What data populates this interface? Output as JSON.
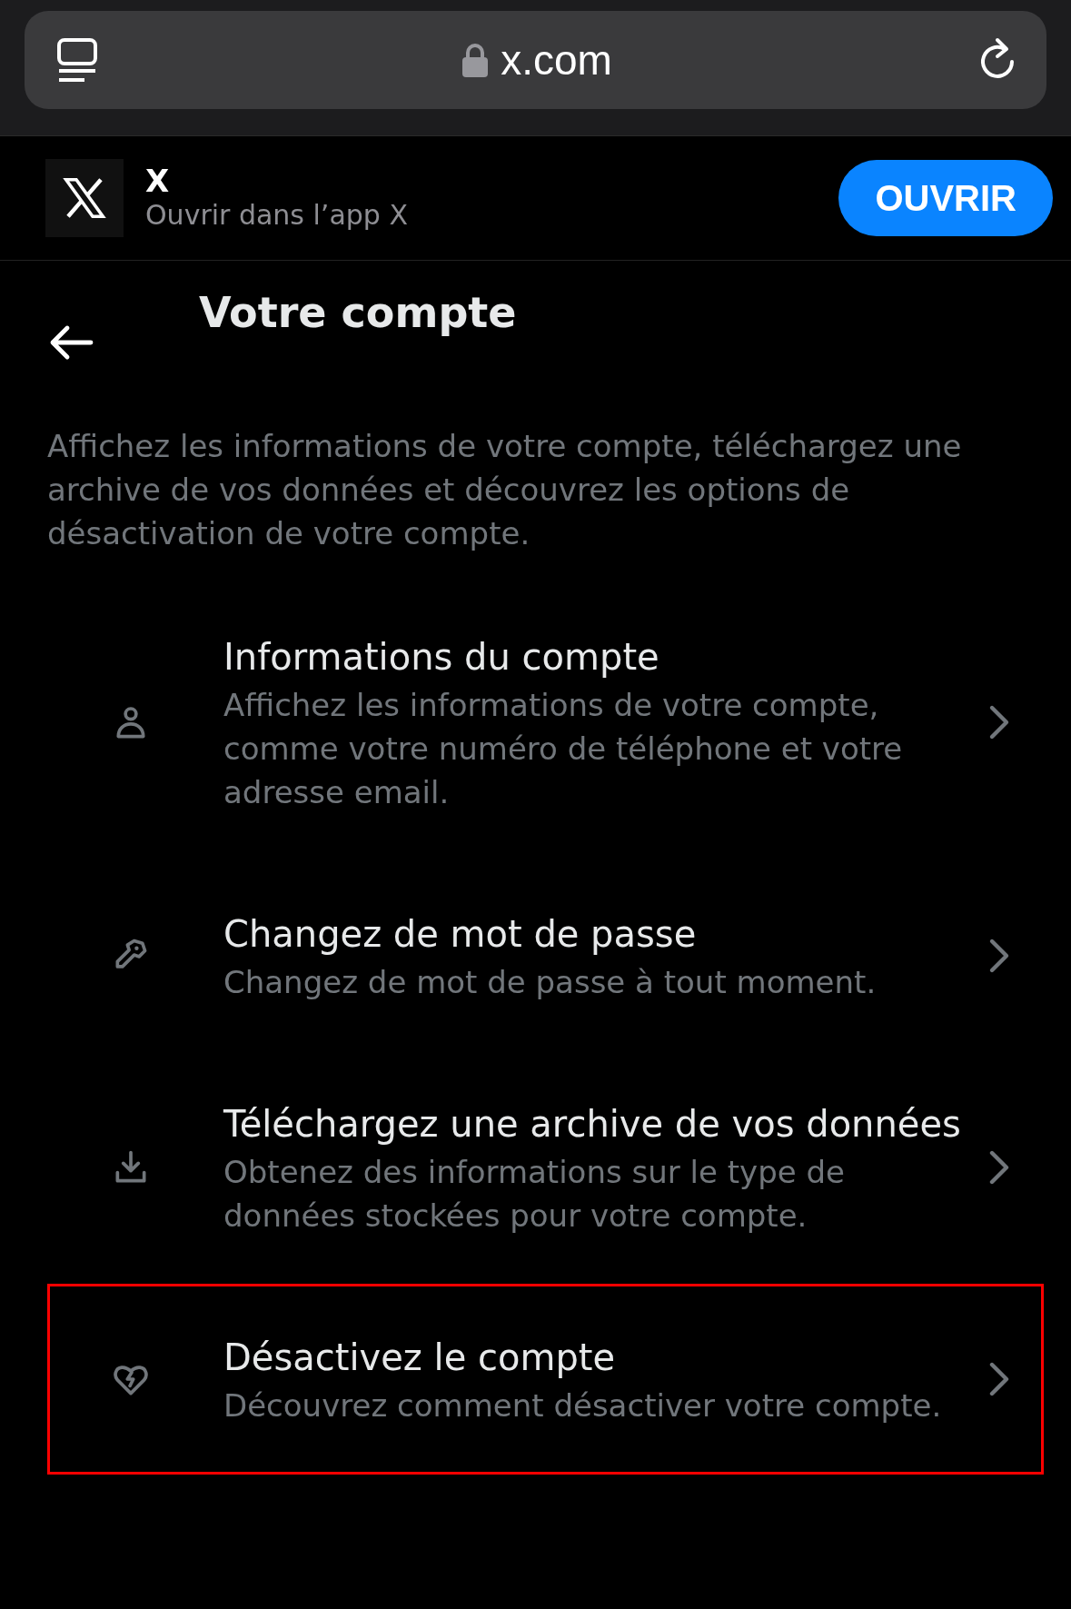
{
  "browser": {
    "url": "x.com"
  },
  "app_banner": {
    "name": "X",
    "subtitle": "Ouvrir dans l’app X",
    "button": "OUVRIR"
  },
  "header": {
    "title": "Votre compte"
  },
  "description": "Affichez les informations de votre compte, téléchargez une archive de vos données et découvrez les options de désactivation de votre compte.",
  "items": [
    {
      "kind": "person",
      "title": "Informations du compte",
      "subtitle": "Affichez les informations de votre compte, comme votre numéro de téléphone et votre adresse email.",
      "highlighted": false
    },
    {
      "kind": "key",
      "title": "Changez de mot de passe",
      "subtitle": "Changez de mot de passe à tout moment.",
      "highlighted": false
    },
    {
      "kind": "download",
      "title": "Téléchargez une archive de vos données",
      "subtitle": "Obtenez des informations sur le type de données stockées pour votre compte.",
      "highlighted": false
    },
    {
      "kind": "broken-heart",
      "title": "Désactivez le compte",
      "subtitle": "Découvrez comment désactiver votre compte.",
      "highlighted": true
    }
  ]
}
